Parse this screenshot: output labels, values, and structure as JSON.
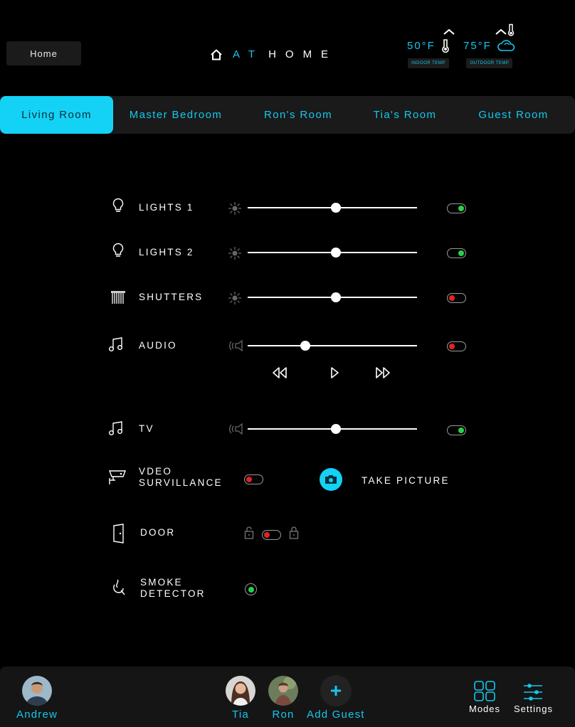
{
  "header": {
    "home_button": "Home",
    "brand_at": "AT",
    "brand_home": "HOME",
    "indoor": {
      "value": "50°F",
      "label": "INDOOR TEMP"
    },
    "outdoor": {
      "value": "75°F",
      "label": "OUTDOOR TEMP"
    }
  },
  "tabs": [
    {
      "label": "Living Room",
      "active": true
    },
    {
      "label": "Master Bedroom",
      "active": false
    },
    {
      "label": "Ron's Room",
      "active": false
    },
    {
      "label": "Tia's Room",
      "active": false
    },
    {
      "label": "Guest Room",
      "active": false
    }
  ],
  "controls": {
    "lights1": {
      "label": "LIGHTS 1",
      "level": 0.52,
      "on": true
    },
    "lights2": {
      "label": "LIGHTS 2",
      "level": 0.52,
      "on": true
    },
    "shutters": {
      "label": "SHUTTERS",
      "level": 0.52,
      "on": false
    },
    "audio": {
      "label": "AUDIO",
      "level": 0.34,
      "on": false
    },
    "tv": {
      "label": "TV",
      "level": 0.52,
      "on": true
    },
    "video": {
      "label_line1": "VDEO",
      "label_line2": "SURVILLANCE",
      "on": false,
      "take_picture": "TAKE PICTURE"
    },
    "door": {
      "label": "DOOR",
      "locked": false
    },
    "smoke": {
      "label_line1": "SMOKE",
      "label_line2": "DETECTOR",
      "ok": true
    }
  },
  "footer": {
    "current_user": "Andrew",
    "guests": [
      "Tia",
      "Ron"
    ],
    "add_guest": "Add Guest",
    "modes": "Modes",
    "settings": "Settings"
  },
  "colors": {
    "accent": "#14c8ee",
    "on": "#27d24a",
    "off": "#e02424"
  }
}
